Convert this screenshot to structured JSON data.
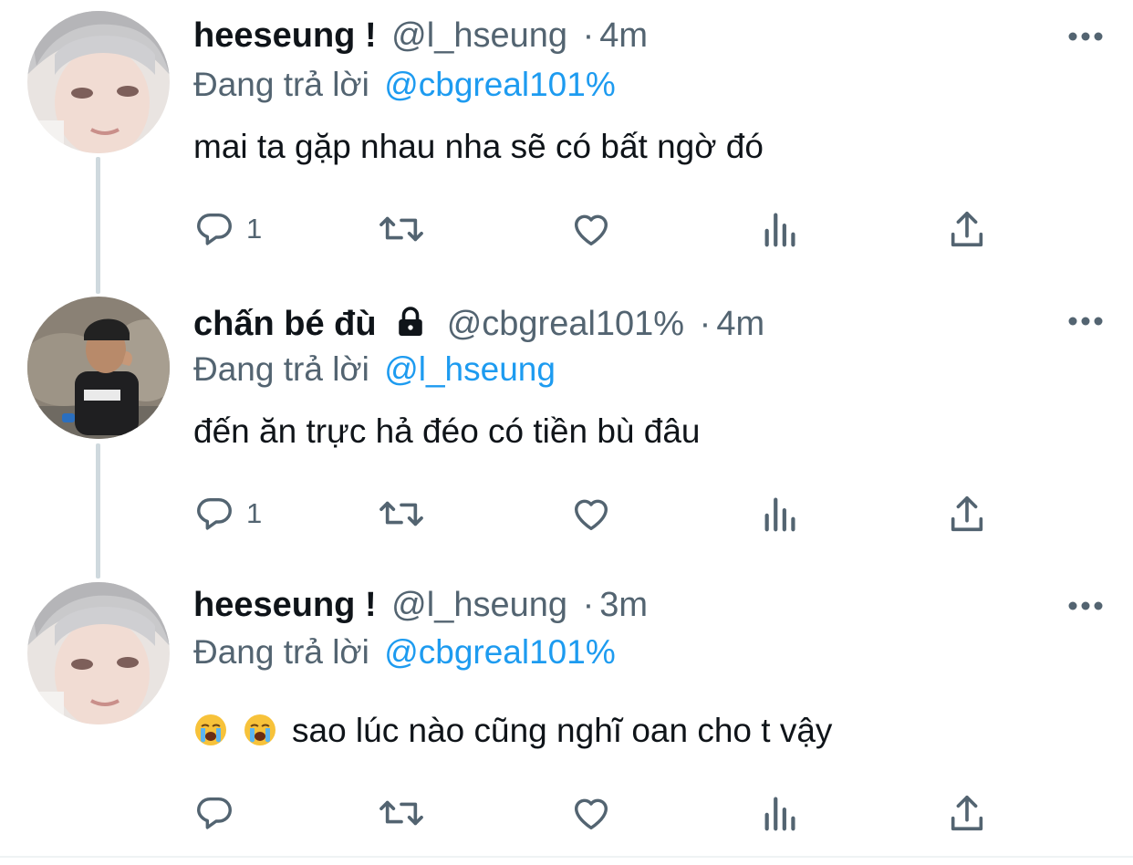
{
  "colors": {
    "text": "#0f1419",
    "secondary": "#536471",
    "accent": "#1d9bf0",
    "line": "#cfd9de"
  },
  "tweets": [
    {
      "name": "heeseung !",
      "handle": "@l_hseung",
      "separator": "·",
      "time": "4m",
      "locked": false,
      "reply_prefix": "Đang trả lời",
      "reply_to": "@cbgreal101%",
      "text": "mai ta gặp nhau nha sẽ có bất ngờ đó",
      "emojis": [],
      "reply_count": "1",
      "icons": [
        "reply-icon",
        "retweet-icon",
        "like-icon",
        "analytics-icon",
        "share-icon"
      ]
    },
    {
      "name": "chấn bé đù",
      "handle": "@cbgreal101%",
      "separator": "·",
      "time": "4m",
      "locked": true,
      "reply_prefix": "Đang trả lời",
      "reply_to": "@l_hseung",
      "text": "đến ăn trực hả đéo có tiền bù đâu",
      "emojis": [],
      "reply_count": "1",
      "icons": [
        "reply-icon",
        "retweet-icon",
        "like-icon",
        "analytics-icon",
        "share-icon"
      ]
    },
    {
      "name": "heeseung !",
      "handle": "@l_hseung",
      "separator": "·",
      "time": "3m",
      "locked": false,
      "reply_prefix": "Đang trả lời",
      "reply_to": "@cbgreal101%",
      "text": "sao lúc nào cũng nghĩ oan cho t vậy",
      "emojis": [
        "loudly-crying-face",
        "loudly-crying-face"
      ],
      "reply_count": "",
      "icons": [
        "reply-icon",
        "retweet-icon",
        "like-icon",
        "analytics-icon",
        "share-icon"
      ]
    }
  ]
}
